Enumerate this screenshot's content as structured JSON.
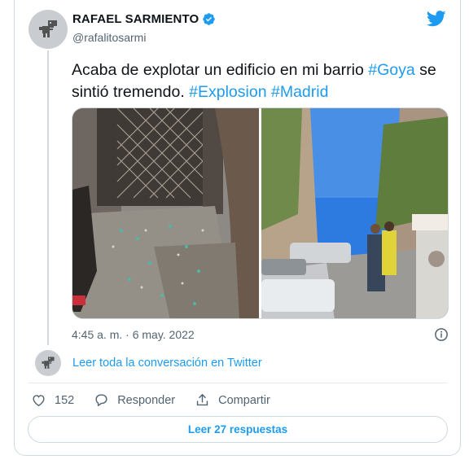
{
  "author": {
    "name": "RAFAEL SARMIENTO",
    "handle": "@rafalitosarmi",
    "verified": true
  },
  "tweet": {
    "text_plain_1": "Acaba de explotar un edificio en mi barrio ",
    "hashtag_1": "#Goya",
    "text_plain_2": " se sintió tremendo. ",
    "hashtag_2": "#Explosion",
    "hashtag_3": "#Madrid",
    "timestamp": "4:45 a. m. · 6 may. 2022"
  },
  "conversation": {
    "link_label": "Leer toda la conversación en Twitter"
  },
  "actions": {
    "like_count": "152",
    "reply_label": "Responder",
    "share_label": "Compartir"
  },
  "replies_button": {
    "label": "Leer 27 respuestas"
  },
  "colors": {
    "accent": "#1d9bf0",
    "secondary_text": "#536471",
    "border": "#cfd9de"
  }
}
